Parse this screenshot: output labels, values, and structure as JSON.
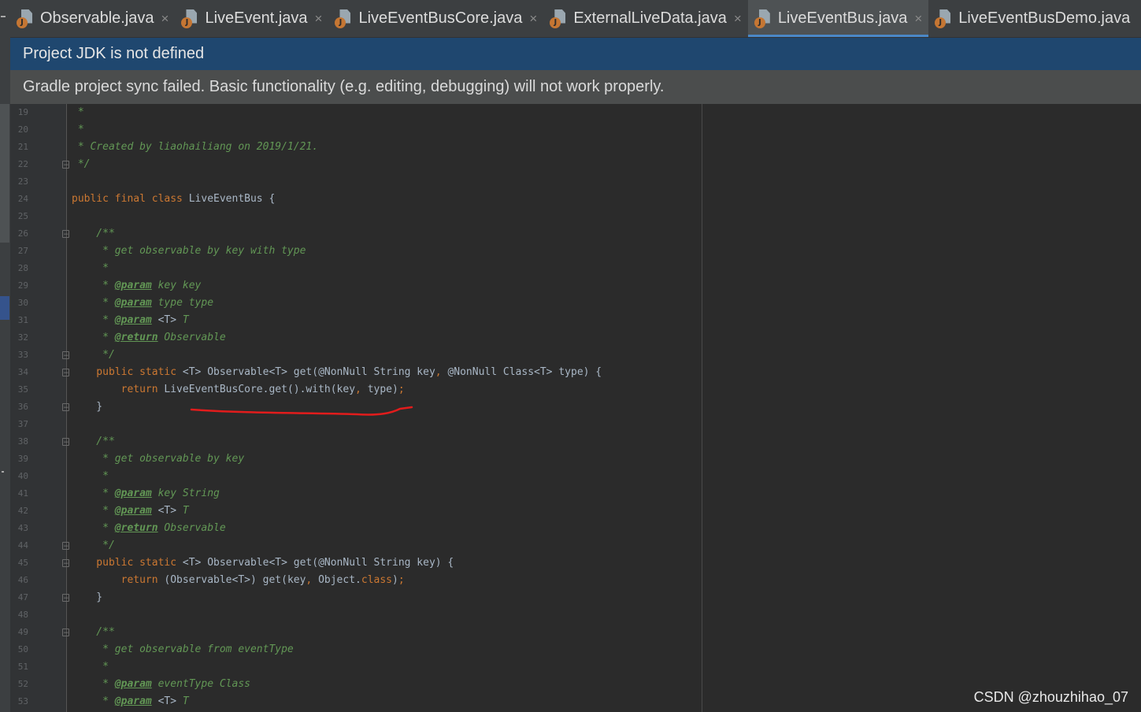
{
  "tabs": [
    {
      "label": "Observable.java",
      "closable": true,
      "active": false
    },
    {
      "label": "LiveEvent.java",
      "closable": true,
      "active": false
    },
    {
      "label": "LiveEventBusCore.java",
      "closable": true,
      "active": false
    },
    {
      "label": "ExternalLiveData.java",
      "closable": true,
      "active": false
    },
    {
      "label": "LiveEventBus.java",
      "closable": true,
      "active": true
    },
    {
      "label": "LiveEventBusDemo.java",
      "closable": false,
      "active": false
    }
  ],
  "icons": {
    "file": "java-class-file-icon",
    "close": "close-icon",
    "badge_letter": "J"
  },
  "close_glyph": "×",
  "banners": {
    "jdk": "Project JDK is not defined",
    "gradle": "Gradle project sync failed. Basic functionality (e.g. editing, debugging) will not work properly."
  },
  "colors": {
    "keyword": "#cc7832",
    "javadoc": "#629755",
    "annotation": "#bbb529",
    "plain": "#a9b7c6",
    "line_number": "#606366",
    "red_annotation_stroke": "#e21c1c",
    "jdk_banner": "#1f476f",
    "gradle_banner": "#4b4d4d"
  },
  "editor": {
    "lines": [
      {
        "n": "19",
        "fold": "",
        "parts": [
          [
            "doc",
            " *"
          ]
        ]
      },
      {
        "n": "20",
        "fold": "",
        "parts": [
          [
            "doc",
            " *"
          ]
        ]
      },
      {
        "n": "21",
        "fold": "",
        "parts": [
          [
            "doc",
            " * Created by liaohailiang on 2019/1/21."
          ]
        ]
      },
      {
        "n": "22",
        "fold": "⊖",
        "parts": [
          [
            "doc",
            " */"
          ]
        ]
      },
      {
        "n": "23",
        "fold": "",
        "parts": []
      },
      {
        "n": "24",
        "fold": "",
        "parts": [
          [
            "kw",
            "public final class "
          ],
          [
            "plain",
            "LiveEventBus {"
          ]
        ]
      },
      {
        "n": "25",
        "fold": "",
        "parts": []
      },
      {
        "n": "26",
        "fold": "⊖",
        "parts": [
          [
            "doc",
            "    /**"
          ]
        ]
      },
      {
        "n": "27",
        "fold": "",
        "parts": [
          [
            "doc",
            "     * get observable by key with type"
          ]
        ]
      },
      {
        "n": "28",
        "fold": "",
        "parts": [
          [
            "doc",
            "     *"
          ]
        ]
      },
      {
        "n": "29",
        "fold": "",
        "parts": [
          [
            "doc",
            "     * "
          ],
          [
            "tag",
            "@param"
          ],
          [
            "doc",
            " key key"
          ]
        ]
      },
      {
        "n": "30",
        "fold": "",
        "parts": [
          [
            "doc",
            "     * "
          ],
          [
            "tag",
            "@param"
          ],
          [
            "doc",
            " type type"
          ]
        ]
      },
      {
        "n": "31",
        "fold": "",
        "parts": [
          [
            "doc",
            "     * "
          ],
          [
            "tag",
            "@param"
          ],
          [
            "plain",
            " <T>"
          ],
          [
            "doc",
            " T"
          ]
        ]
      },
      {
        "n": "32",
        "fold": "",
        "parts": [
          [
            "doc",
            "     * "
          ],
          [
            "tag",
            "@return"
          ],
          [
            "doc",
            " Observable"
          ]
        ]
      },
      {
        "n": "33",
        "fold": "⊖",
        "parts": [
          [
            "doc",
            "     */"
          ]
        ]
      },
      {
        "n": "34",
        "fold": "⊖",
        "parts": [
          [
            "kw",
            "    public static "
          ],
          [
            "plain",
            "<T> Observable<T> get(@NonNull String key"
          ],
          [
            "punc",
            ", "
          ],
          [
            "plain",
            "@NonNull Class<T> type) {"
          ]
        ]
      },
      {
        "n": "35",
        "fold": "",
        "parts": [
          [
            "kw",
            "        return "
          ],
          [
            "plain",
            "LiveEventBusCore.get().with(key"
          ],
          [
            "punc",
            ", "
          ],
          [
            "plain",
            "type)"
          ],
          [
            "punc",
            ";"
          ]
        ]
      },
      {
        "n": "36",
        "fold": "⊖",
        "parts": [
          [
            "plain",
            "    }"
          ]
        ]
      },
      {
        "n": "37",
        "fold": "",
        "parts": []
      },
      {
        "n": "38",
        "fold": "⊖",
        "parts": [
          [
            "doc",
            "    /**"
          ]
        ]
      },
      {
        "n": "39",
        "fold": "",
        "parts": [
          [
            "doc",
            "     * get observable by key"
          ]
        ]
      },
      {
        "n": "40",
        "fold": "",
        "parts": [
          [
            "doc",
            "     *"
          ]
        ]
      },
      {
        "n": "41",
        "fold": "",
        "parts": [
          [
            "doc",
            "     * "
          ],
          [
            "tag",
            "@param"
          ],
          [
            "doc",
            " key String"
          ]
        ]
      },
      {
        "n": "42",
        "fold": "",
        "parts": [
          [
            "doc",
            "     * "
          ],
          [
            "tag",
            "@param"
          ],
          [
            "plain",
            " <T>"
          ],
          [
            "doc",
            " T"
          ]
        ]
      },
      {
        "n": "43",
        "fold": "",
        "parts": [
          [
            "doc",
            "     * "
          ],
          [
            "tag",
            "@return"
          ],
          [
            "doc",
            " Observable"
          ]
        ]
      },
      {
        "n": "44",
        "fold": "⊖",
        "parts": [
          [
            "doc",
            "     */"
          ]
        ]
      },
      {
        "n": "45",
        "fold": "⊖",
        "parts": [
          [
            "kw",
            "    public static "
          ],
          [
            "plain",
            "<T> Observable<T> get(@NonNull String key) {"
          ]
        ]
      },
      {
        "n": "46",
        "fold": "",
        "parts": [
          [
            "kw",
            "        return "
          ],
          [
            "plain",
            "(Observable<T>) get(key"
          ],
          [
            "punc",
            ", "
          ],
          [
            "plain",
            "Object."
          ],
          [
            "kw",
            "class"
          ],
          [
            "plain",
            ")"
          ],
          [
            "punc",
            ";"
          ]
        ]
      },
      {
        "n": "47",
        "fold": "⊖",
        "parts": [
          [
            "plain",
            "    }"
          ]
        ]
      },
      {
        "n": "48",
        "fold": "",
        "parts": []
      },
      {
        "n": "49",
        "fold": "⊖",
        "parts": [
          [
            "doc",
            "    /**"
          ]
        ]
      },
      {
        "n": "50",
        "fold": "",
        "parts": [
          [
            "doc",
            "     * get observable from eventType"
          ]
        ]
      },
      {
        "n": "51",
        "fold": "",
        "parts": [
          [
            "doc",
            "     *"
          ]
        ]
      },
      {
        "n": "52",
        "fold": "",
        "parts": [
          [
            "doc",
            "     * "
          ],
          [
            "tag",
            "@param"
          ],
          [
            "doc",
            " eventType Class"
          ]
        ]
      },
      {
        "n": "53",
        "fold": "",
        "parts": [
          [
            "doc",
            "     * "
          ],
          [
            "tag",
            "@param"
          ],
          [
            "plain",
            " <T>"
          ],
          [
            "doc",
            " T"
          ]
        ]
      }
    ]
  },
  "watermark": "CSDN @zhouzhihao_07"
}
